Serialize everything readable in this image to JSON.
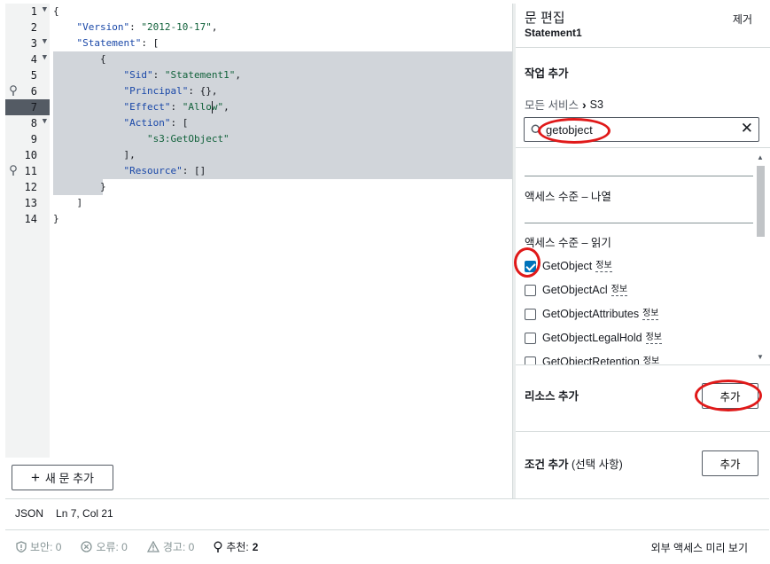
{
  "editor": {
    "lines": [
      {
        "num": "1",
        "fold": true,
        "tokens": [
          {
            "t": "p",
            "v": "{"
          }
        ]
      },
      {
        "num": "2",
        "tokens": [
          {
            "t": "p",
            "v": "    "
          },
          {
            "t": "key",
            "v": "\"Version\""
          },
          {
            "t": "p",
            "v": ": "
          },
          {
            "t": "str",
            "v": "\"2012-10-17\""
          },
          {
            "t": "p",
            "v": ","
          }
        ]
      },
      {
        "num": "3",
        "fold": true,
        "tokens": [
          {
            "t": "p",
            "v": "    "
          },
          {
            "t": "key",
            "v": "\"Statement\""
          },
          {
            "t": "p",
            "v": ": ["
          }
        ]
      },
      {
        "num": "4",
        "fold": true,
        "tokens": [
          {
            "t": "p",
            "v": "        {"
          }
        ]
      },
      {
        "num": "5",
        "tokens": [
          {
            "t": "p",
            "v": "            "
          },
          {
            "t": "key",
            "v": "\"Sid\""
          },
          {
            "t": "p",
            "v": ": "
          },
          {
            "t": "str",
            "v": "\"Statement1\""
          },
          {
            "t": "p",
            "v": ","
          }
        ]
      },
      {
        "num": "6",
        "bulb": true,
        "tokens": [
          {
            "t": "p",
            "v": "            "
          },
          {
            "t": "key",
            "v": "\"Principal\""
          },
          {
            "t": "p",
            "v": ": {},"
          }
        ]
      },
      {
        "num": "7",
        "active": true,
        "tokens": [
          {
            "t": "p",
            "v": "            "
          },
          {
            "t": "key",
            "v": "\"Effect\""
          },
          {
            "t": "p",
            "v": ": "
          },
          {
            "t": "str",
            "v": "\"Allow\""
          },
          {
            "t": "p",
            "v": ","
          }
        ]
      },
      {
        "num": "8",
        "fold": true,
        "tokens": [
          {
            "t": "p",
            "v": "            "
          },
          {
            "t": "key",
            "v": "\"Action\""
          },
          {
            "t": "p",
            "v": ": ["
          }
        ]
      },
      {
        "num": "9",
        "tokens": [
          {
            "t": "p",
            "v": "                "
          },
          {
            "t": "str",
            "v": "\"s3:GetObject\""
          }
        ]
      },
      {
        "num": "10",
        "tokens": [
          {
            "t": "p",
            "v": "            ],"
          }
        ]
      },
      {
        "num": "11",
        "bulb": true,
        "tokens": [
          {
            "t": "p",
            "v": "            "
          },
          {
            "t": "key",
            "v": "\"Resource\""
          },
          {
            "t": "p",
            "v": ": []"
          }
        ]
      },
      {
        "num": "12",
        "tokens": [
          {
            "t": "p",
            "v": "        }"
          }
        ]
      },
      {
        "num": "13",
        "tokens": [
          {
            "t": "p",
            "v": "    ]"
          }
        ]
      },
      {
        "num": "14",
        "tokens": [
          {
            "t": "p",
            "v": "}"
          }
        ]
      }
    ],
    "new_statement_label": "새 문 추가"
  },
  "status": {
    "language": "JSON",
    "position": "Ln 7, Col 21"
  },
  "footer": {
    "security": "보안: 0",
    "errors": "오류: 0",
    "warnings": "경고: 0",
    "recommendations_label": "추천:",
    "recommendations_count": "2",
    "preview_external_access": "외부 액세스 미리 보기"
  },
  "panel": {
    "title": "문 편집",
    "statement_name": "Statement1",
    "remove_label": "제거",
    "add_action_title": "작업 추가",
    "breadcrumb_all_services": "모든 서비스",
    "breadcrumb_service": "S3",
    "search_value": "getobject",
    "group_list": "액세스 수준 – 나열",
    "group_read": "액세스 수준 – 읽기",
    "actions": [
      {
        "name": "GetObject",
        "checked": true,
        "info": "정보"
      },
      {
        "name": "GetObjectAcl",
        "checked": false,
        "info": "정보"
      },
      {
        "name": "GetObjectAttributes",
        "checked": false,
        "info": "정보"
      },
      {
        "name": "GetObjectLegalHold",
        "checked": false,
        "info": "정보"
      },
      {
        "name": "GetObjectRetention",
        "checked": false,
        "info": "정보"
      }
    ],
    "add_resource_title": "리소스 추가",
    "add_resource_button": "추가",
    "add_condition_title": "조건 추가",
    "add_condition_optional": "(선택 사항)",
    "add_condition_button": "추가"
  },
  "colors": {
    "selection": "#d1d5da",
    "checkbox_checked": "#0073bb",
    "annotation": "#e01919",
    "json_key": "#1a48a8",
    "json_string": "#12623b"
  }
}
